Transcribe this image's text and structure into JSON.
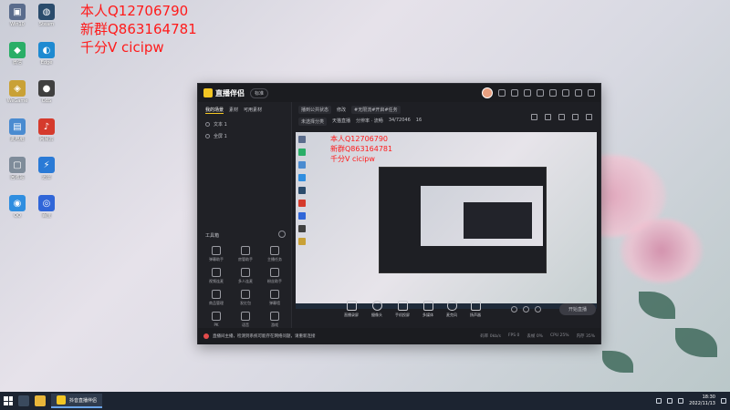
{
  "overlay": {
    "line1": "本人Q12706790",
    "line2": "新群Q863164781",
    "line3": "千分V cicipw"
  },
  "desktop_icons": [
    {
      "label": "Win10",
      "color": "#5a6c8c",
      "glyph": "▣"
    },
    {
      "label": "微信",
      "color": "#2aae67",
      "glyph": "◆"
    },
    {
      "label": "WeGame",
      "color": "#c9a136",
      "glyph": "◈"
    },
    {
      "label": "此电脑",
      "color": "#4a8bd0",
      "glyph": "▤"
    },
    {
      "label": "回收站",
      "color": "#7f8c9a",
      "glyph": "▢"
    },
    {
      "label": "QQ",
      "color": "#2f8ee0",
      "glyph": "◉"
    },
    {
      "label": "Steam",
      "color": "#2b4c6c",
      "glyph": "◍"
    },
    {
      "label": "Edge",
      "color": "#1e8ad1",
      "glyph": "◐"
    },
    {
      "label": "OBS",
      "color": "#404040",
      "glyph": "●"
    },
    {
      "label": "网易云",
      "color": "#d53a2c",
      "glyph": "♪"
    },
    {
      "label": "迅雷",
      "color": "#2a7ad6",
      "glyph": "⚡"
    },
    {
      "label": "百度",
      "color": "#3066d8",
      "glyph": "◎"
    }
  ],
  "app": {
    "brand": "直播伴侣",
    "edition": "标准",
    "side_tabs": [
      "我的场景",
      "素材",
      "可用素材"
    ],
    "scenes": [
      "文本 1",
      "全屏 1"
    ],
    "tools_title": "工具箱",
    "tools": [
      "弹幕助手",
      "房管助手",
      "主播任务",
      "视频连麦",
      "多人连麦",
      "粉丝助手",
      "商品管理",
      "发红包",
      "弹幕墙",
      "PK",
      "语音",
      "游戏"
    ],
    "info": {
      "title_pill": "播到公共状态",
      "edit": "修改",
      "tags_pill": "#无限流#开启#任务",
      "category_pill": "未选择分类",
      "platform": "天猫直播",
      "quality": "分辨率 · 流畅",
      "resolution": "34/72046",
      "viewers": "16"
    },
    "controls": [
      "直播录屏",
      "摄像头",
      "手机投屏",
      "多媒体",
      "麦克风",
      "扬声器"
    ],
    "start_button": "开始直播",
    "status_notice": "直播间主播，检测到系统可能存在网络问题，请重新连接",
    "stats": [
      "码率 0kb/s",
      "FPS 0",
      "丢帧 0%",
      "CPU 25%",
      "内存 35%"
    ]
  },
  "taskbar": {
    "active_app": "抖音直播伴侣",
    "time": "18:30",
    "date": "2022/11/13"
  }
}
